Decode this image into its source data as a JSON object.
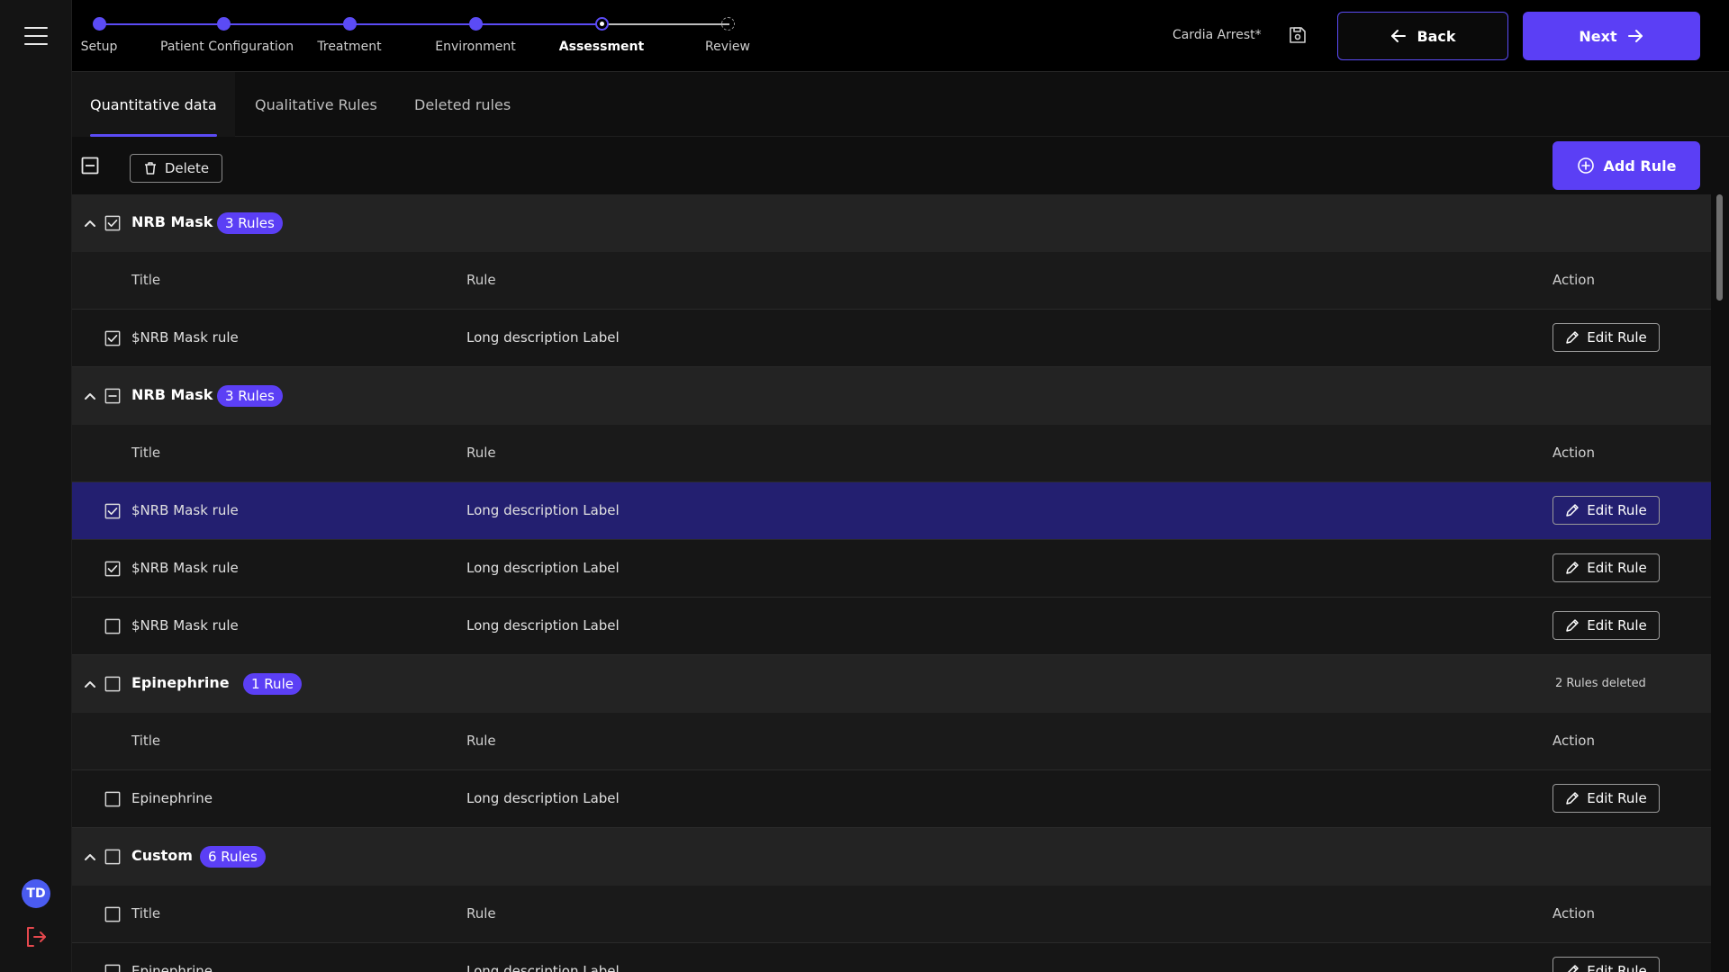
{
  "header": {
    "steps": [
      {
        "label": "Setup",
        "state": "done"
      },
      {
        "label": "Patient Configuration",
        "state": "done"
      },
      {
        "label": "Treatment",
        "state": "done"
      },
      {
        "label": "Environment",
        "state": "done"
      },
      {
        "label": "Assessment",
        "state": "current"
      },
      {
        "label": "Review",
        "state": "pending"
      }
    ],
    "case_name": "Cardia Arrest*",
    "back_label": "Back",
    "next_label": "Next"
  },
  "tabs": [
    {
      "label": "Quantitative data",
      "active": true
    },
    {
      "label": "Qualitative Rules",
      "active": false
    },
    {
      "label": "Deleted rules",
      "active": false
    }
  ],
  "toolbar": {
    "delete_label": "Delete",
    "add_rule_label": "Add Rule"
  },
  "user": {
    "initials": "TD"
  },
  "colors": {
    "accent": "#5b3ff5",
    "selected_row": "#231f70",
    "logout": "#e5484d"
  },
  "columns": {
    "title": "Title",
    "rule": "Rule",
    "action": "Action"
  },
  "edit_label": "Edit Rule",
  "groups": [
    {
      "name": "NRB Mask",
      "badge": "3 Rules",
      "state": "checked",
      "note": "",
      "header_checkbox": false,
      "rows": [
        {
          "title": "$NRB Mask rule",
          "rule": "Long description Label",
          "checked": true,
          "selected": false
        }
      ]
    },
    {
      "name": "NRB Mask",
      "badge": "3 Rules",
      "state": "partial",
      "note": "",
      "header_checkbox": false,
      "rows": [
        {
          "title": "$NRB Mask rule",
          "rule": "Long description Label",
          "checked": true,
          "selected": true
        },
        {
          "title": "$NRB Mask rule",
          "rule": "Long description Label",
          "checked": true,
          "selected": false
        },
        {
          "title": "$NRB Mask rule",
          "rule": "Long description Label",
          "checked": false,
          "selected": false
        }
      ]
    },
    {
      "name": "Epinephrine",
      "badge": "1 Rule",
      "state": "unchecked",
      "note": "2 Rules deleted",
      "header_checkbox": false,
      "rows": [
        {
          "title": "Epinephrine",
          "rule": "Long description Label",
          "checked": false,
          "selected": false
        }
      ]
    },
    {
      "name": "Custom",
      "badge": "6 Rules",
      "state": "unchecked",
      "note": "",
      "header_checkbox": true,
      "rows": [
        {
          "title": "Epinephrine",
          "rule": "Long description Label",
          "checked": false,
          "selected": false
        }
      ]
    }
  ]
}
